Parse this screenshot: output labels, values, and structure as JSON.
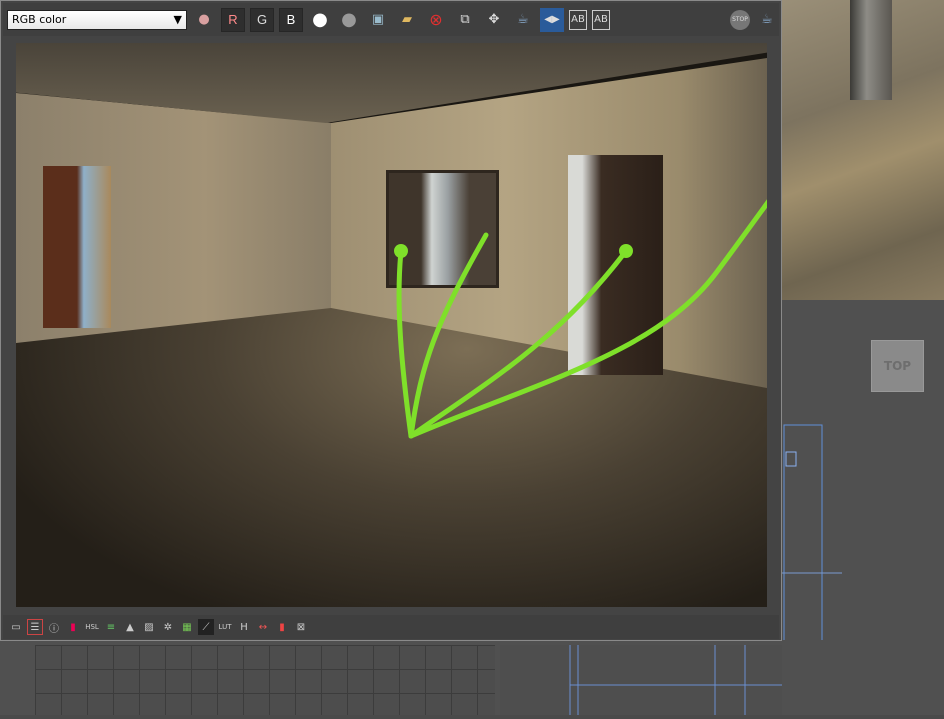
{
  "toolbar": {
    "channel_select": "RGB color",
    "buttons": [
      {
        "name": "display-channels-icon",
        "glyph": "●"
      },
      {
        "name": "red-channel-button",
        "glyph": "R",
        "color": "#ff8a8a"
      },
      {
        "name": "green-channel-button",
        "glyph": "G",
        "color": "#cccccc"
      },
      {
        "name": "blue-channel-button",
        "glyph": "B",
        "color": "#ffffff"
      },
      {
        "name": "white-swatch-icon",
        "glyph": "●"
      },
      {
        "name": "gray-swatch-icon",
        "glyph": "●"
      },
      {
        "name": "save-image-icon",
        "glyph": "💾"
      },
      {
        "name": "open-folder-icon",
        "glyph": "📂"
      },
      {
        "name": "clear-icon",
        "glyph": "✖"
      },
      {
        "name": "clone-window-icon",
        "glyph": "⧉"
      },
      {
        "name": "region-select-icon",
        "glyph": "✥"
      },
      {
        "name": "teapot-render-icon",
        "glyph": "☕"
      },
      {
        "name": "compare-icon",
        "glyph": "◧"
      },
      {
        "name": "ab-compare-a-icon",
        "glyph": "A"
      },
      {
        "name": "ab-compare-b-icon",
        "glyph": "B"
      }
    ],
    "right_buttons": [
      {
        "name": "stop-icon",
        "glyph": "STOP"
      },
      {
        "name": "render-teapot-icon",
        "glyph": "☕"
      }
    ]
  },
  "bottom_toolbar": [
    "▭",
    "☰",
    "ⓘ",
    "▮",
    "HSL",
    "≡",
    "▲",
    "▨",
    "✲",
    "▦",
    "⟋",
    "LUT",
    "H",
    "↔",
    "▮",
    "⊠"
  ],
  "viewport": {
    "cube_label": "TOP"
  },
  "colors": {
    "stroke": "#7fe02a"
  }
}
